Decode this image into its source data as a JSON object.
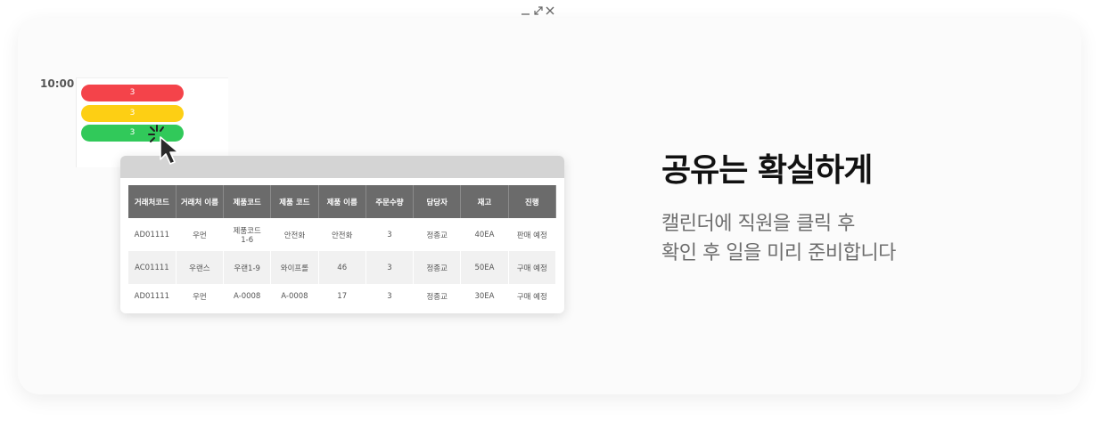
{
  "calendar": {
    "time": "10:00",
    "events": [
      {
        "label": "3",
        "color": "#f4434a"
      },
      {
        "label": "3",
        "color": "#fdcf14"
      },
      {
        "label": "3",
        "color": "#31c95a"
      }
    ]
  },
  "popup": {
    "columns": [
      "거래처코드",
      "거래처 이름",
      "제품코드",
      "제품 코드",
      "제품 이름",
      "주문수량",
      "담당자",
      "재고",
      "진행"
    ],
    "rows": [
      [
        "AD01111",
        "우먼",
        "제품코드\n1-6",
        "안전화",
        "안전화",
        "3",
        "정종교",
        "40EA",
        "판매 예정"
      ],
      [
        "AC01111",
        "우랜스",
        "우랜1-9",
        "와이프롤",
        "46",
        "3",
        "정종교",
        "50EA",
        "구매 예정"
      ],
      [
        "AD01111",
        "우먼",
        "A-0008",
        "A-0008",
        "17",
        "3",
        "정종교",
        "30EA",
        "구매 예정"
      ]
    ]
  },
  "headline": "공유는 확실하게",
  "subtext": [
    "캘린더에 직원을 클릭 후",
    "확인 후 일을 미리 준비합니다"
  ]
}
